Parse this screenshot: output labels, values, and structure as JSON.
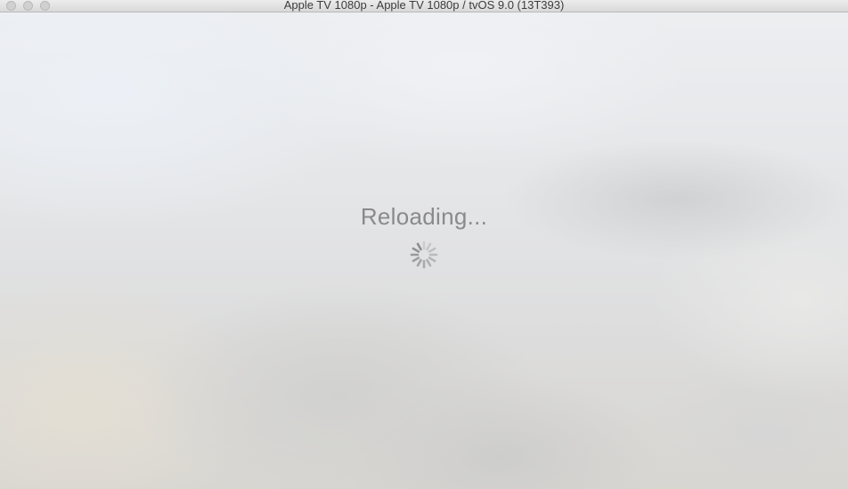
{
  "window": {
    "title": "Apple TV 1080p - Apple TV 1080p / tvOS 9.0 (13T393)"
  },
  "screen": {
    "status_text": "Reloading..."
  },
  "icons": {
    "close": "close-icon",
    "minimize": "minimize-icon",
    "zoom": "zoom-icon",
    "spinner": "activity-spinner-icon"
  },
  "colors": {
    "status_text": "#8a8a8c",
    "spinner": "#8e8e90"
  }
}
